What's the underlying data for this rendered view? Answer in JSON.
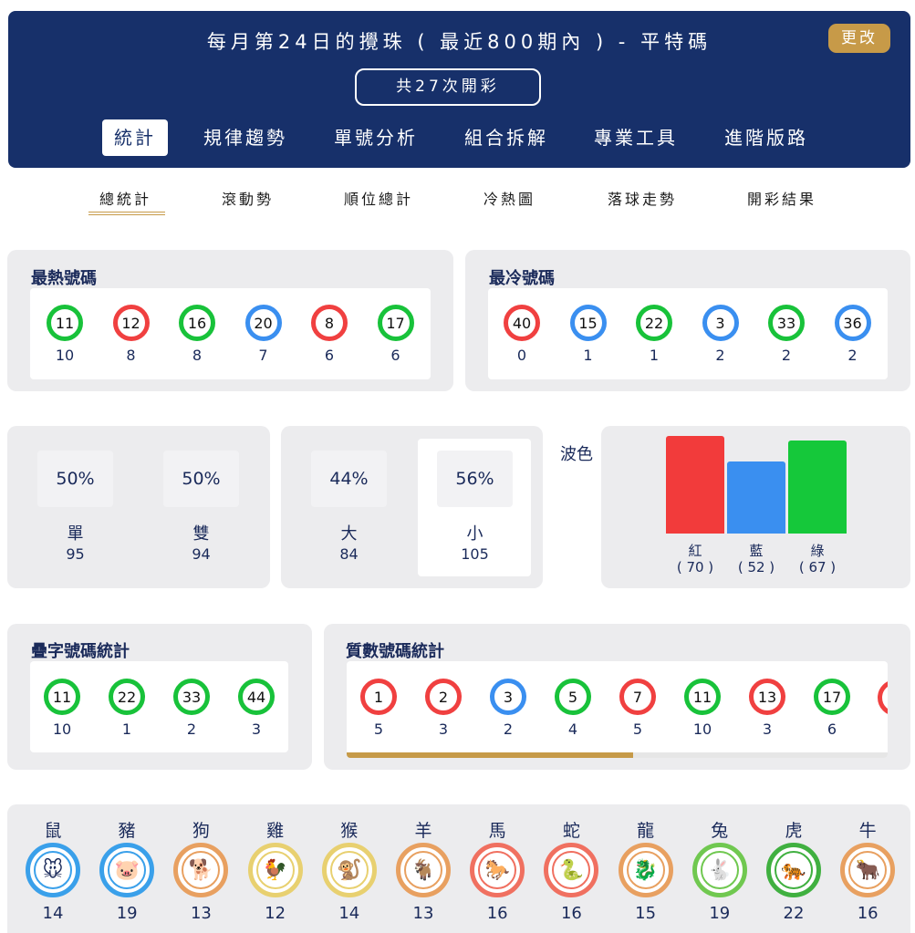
{
  "header": {
    "title": "每月第24日的攪珠 ( 最近800期內 ) - 平特碼",
    "edit_label": "更改",
    "draw_count": "共27次開彩",
    "tabs": [
      "統計",
      "規律趨勢",
      "單號分析",
      "組合拆解",
      "專業工具",
      "進階版路"
    ]
  },
  "sub_tabs": [
    "總統計",
    "滾動勢",
    "順位總計",
    "冷熱圖",
    "落球走勢",
    "開彩結果"
  ],
  "hottest": {
    "title": "最熱號碼",
    "balls": [
      {
        "num": "11",
        "color": "green",
        "count": "10"
      },
      {
        "num": "12",
        "color": "red",
        "count": "8"
      },
      {
        "num": "16",
        "color": "green",
        "count": "8"
      },
      {
        "num": "20",
        "color": "blue",
        "count": "7"
      },
      {
        "num": "8",
        "color": "red",
        "count": "6"
      },
      {
        "num": "17",
        "color": "green",
        "count": "6"
      }
    ]
  },
  "coldest": {
    "title": "最冷號碼",
    "balls": [
      {
        "num": "40",
        "color": "red",
        "count": "0"
      },
      {
        "num": "15",
        "color": "blue",
        "count": "1"
      },
      {
        "num": "22",
        "color": "green",
        "count": "1"
      },
      {
        "num": "3",
        "color": "blue",
        "count": "2"
      },
      {
        "num": "33",
        "color": "green",
        "count": "2"
      },
      {
        "num": "36",
        "color": "blue",
        "count": "2"
      }
    ]
  },
  "odd_even": [
    {
      "pct": "50%",
      "label": "單",
      "count": "95"
    },
    {
      "pct": "50%",
      "label": "雙",
      "count": "94"
    }
  ],
  "big_small": [
    {
      "pct": "44%",
      "label": "大",
      "count": "84"
    },
    {
      "pct": "56%",
      "label": "小",
      "count": "105"
    }
  ],
  "wave_color": {
    "title": "波色",
    "bars": [
      {
        "label": "紅",
        "value_text": "( 70 )",
        "value": 70,
        "color": "#f23b3b"
      },
      {
        "label": "藍",
        "value_text": "( 52 )",
        "value": 52,
        "color": "#3a8ff0"
      },
      {
        "label": "綠",
        "value_text": "( 67 )",
        "value": 67,
        "color": "#15c83a"
      }
    ]
  },
  "repeat_digits": {
    "title": "疊字號碼統計",
    "balls": [
      {
        "num": "11",
        "color": "green",
        "count": "10"
      },
      {
        "num": "22",
        "color": "green",
        "count": "1"
      },
      {
        "num": "33",
        "color": "green",
        "count": "2"
      },
      {
        "num": "44",
        "color": "green",
        "count": "3"
      }
    ]
  },
  "primes": {
    "title": "質數號碼統計",
    "scroll_progress": 0.53,
    "balls": [
      {
        "num": "1",
        "color": "red",
        "count": "5"
      },
      {
        "num": "2",
        "color": "red",
        "count": "3"
      },
      {
        "num": "3",
        "color": "blue",
        "count": "2"
      },
      {
        "num": "5",
        "color": "green",
        "count": "4"
      },
      {
        "num": "7",
        "color": "red",
        "count": "5"
      },
      {
        "num": "11",
        "color": "green",
        "count": "10"
      },
      {
        "num": "13",
        "color": "red",
        "count": "3"
      },
      {
        "num": "17",
        "color": "green",
        "count": "6"
      }
    ]
  },
  "zodiac": [
    {
      "name": "鼠",
      "count": "14",
      "ring": "#3aa0ea",
      "icon": "rat-icon",
      "glyph": "🐭"
    },
    {
      "name": "豬",
      "count": "19",
      "ring": "#3aa0ea",
      "icon": "pig-icon",
      "glyph": "🐷"
    },
    {
      "name": "狗",
      "count": "13",
      "ring": "#e8a060",
      "icon": "dog-icon",
      "glyph": "🐕"
    },
    {
      "name": "雞",
      "count": "12",
      "ring": "#e8d070",
      "icon": "rooster-icon",
      "glyph": "🐓"
    },
    {
      "name": "猴",
      "count": "14",
      "ring": "#e8d070",
      "icon": "monkey-icon",
      "glyph": "🐒"
    },
    {
      "name": "羊",
      "count": "13",
      "ring": "#e8a060",
      "icon": "goat-icon",
      "glyph": "🐐"
    },
    {
      "name": "馬",
      "count": "16",
      "ring": "#f07060",
      "icon": "horse-icon",
      "glyph": "🐎"
    },
    {
      "name": "蛇",
      "count": "16",
      "ring": "#f07060",
      "icon": "snake-icon",
      "glyph": "🐍"
    },
    {
      "name": "龍",
      "count": "15",
      "ring": "#e8a060",
      "icon": "dragon-icon",
      "glyph": "🐉"
    },
    {
      "name": "兔",
      "count": "19",
      "ring": "#70c850",
      "icon": "rabbit-icon",
      "glyph": "🐇"
    },
    {
      "name": "虎",
      "count": "22",
      "ring": "#40b040",
      "icon": "tiger-icon",
      "glyph": "🐅"
    },
    {
      "name": "牛",
      "count": "16",
      "ring": "#e8a060",
      "icon": "ox-icon",
      "glyph": "🐂"
    }
  ]
}
